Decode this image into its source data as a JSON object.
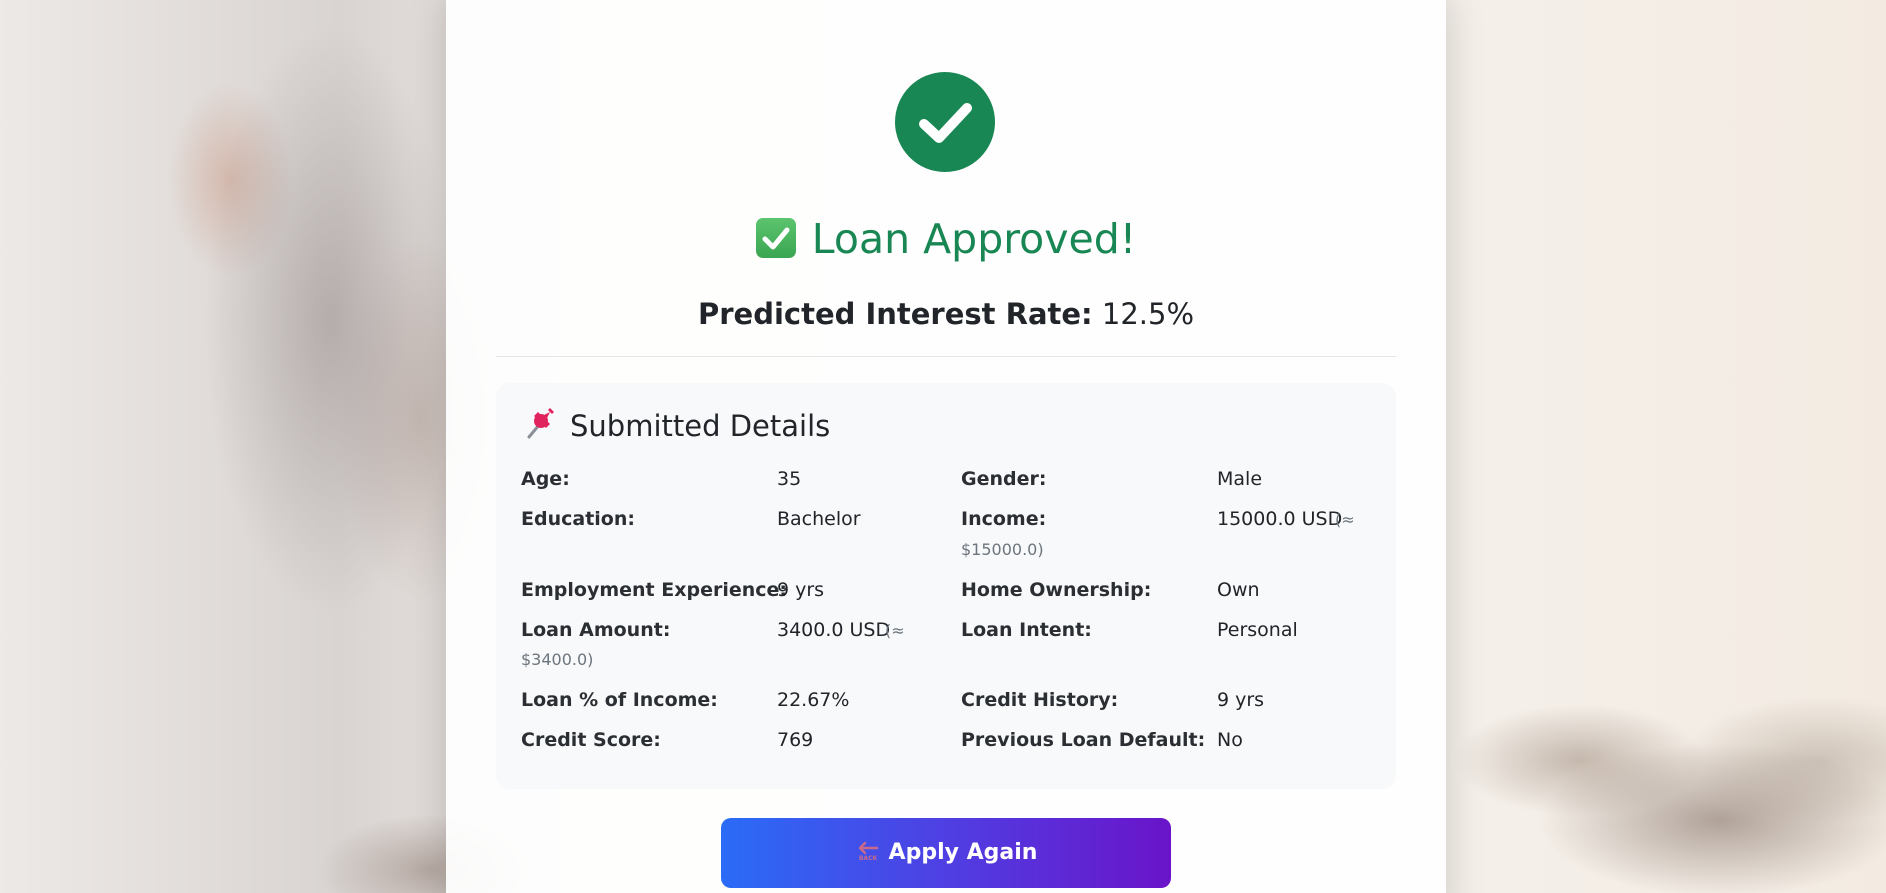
{
  "result": {
    "title": "Loan Approved!",
    "rate_label": "Predicted Interest Rate:",
    "rate_value": "12.5%"
  },
  "details": {
    "title": "Submitted Details",
    "rows": [
      {
        "label": "Age:",
        "value": "35",
        "approx": ""
      },
      {
        "label": "Gender:",
        "value": "Male",
        "approx": ""
      },
      {
        "label": "Education:",
        "value": "Bachelor",
        "approx": ""
      },
      {
        "label": "Income:",
        "value": "15000.0 USD",
        "approx": "(≈ $15000.0)"
      },
      {
        "label": "Employment Experience:",
        "value": "9 yrs",
        "approx": ""
      },
      {
        "label": "Home Ownership:",
        "value": "Own",
        "approx": ""
      },
      {
        "label": "Loan Amount:",
        "value": "3400.0 USD",
        "approx": "(≈ $3400.0)"
      },
      {
        "label": "Loan Intent:",
        "value": "Personal",
        "approx": ""
      },
      {
        "label": "Loan % of Income:",
        "value": "22.67%",
        "approx": ""
      },
      {
        "label": "Credit History:",
        "value": "9 yrs",
        "approx": ""
      },
      {
        "label": "Credit Score:",
        "value": "769",
        "approx": ""
      },
      {
        "label": "Previous Loan Default:",
        "value": "No",
        "approx": ""
      }
    ]
  },
  "actions": {
    "apply_again_label": "Apply Again",
    "back_icon_text": "BACK"
  },
  "colors": {
    "success": "#198754",
    "button_gradient_start": "#2a6cf6",
    "button_gradient_end": "#6a14c9"
  },
  "icons": {
    "status": "check-circle-icon",
    "title_emoji": "check-box-emoji-icon",
    "details_emoji": "pushpin-icon",
    "button": "back-arrow-icon"
  }
}
